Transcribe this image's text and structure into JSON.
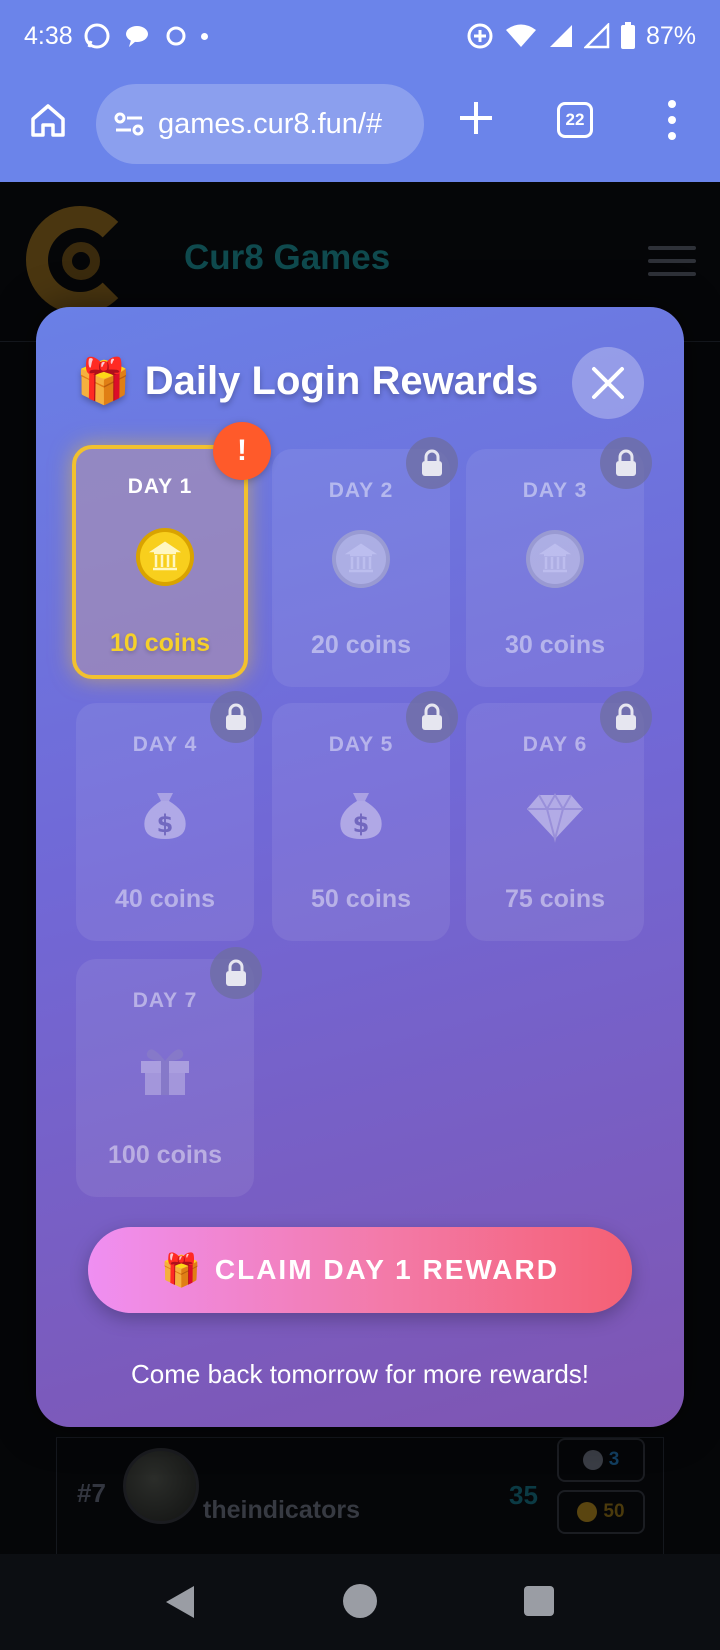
{
  "status_bar": {
    "time": "4:38",
    "battery": "87%"
  },
  "browser": {
    "url": "games.cur8.fun/#",
    "tab_count": "22"
  },
  "background_page": {
    "site_title": "Cur8 Games",
    "leaderboard_row": {
      "rank": "#7",
      "username": "theindicators",
      "score": "35",
      "steem_count": "3",
      "coins_count": "50"
    }
  },
  "modal": {
    "title_icon": "🎁",
    "title": "Daily Login Rewards",
    "days": [
      {
        "label": "DAY 1",
        "coins": "10 coins",
        "icon": "gold-coin-icon",
        "state": "active",
        "badge": "!"
      },
      {
        "label": "DAY 2",
        "coins": "20 coins",
        "icon": "silver-coin-icon",
        "state": "locked"
      },
      {
        "label": "DAY 3",
        "coins": "30 coins",
        "icon": "silver-coin-icon",
        "state": "locked"
      },
      {
        "label": "DAY 4",
        "coins": "40 coins",
        "icon": "money-bag-icon",
        "state": "locked"
      },
      {
        "label": "DAY 5",
        "coins": "50 coins",
        "icon": "money-bag-icon",
        "state": "locked"
      },
      {
        "label": "DAY 6",
        "coins": "75 coins",
        "icon": "gem-icon",
        "state": "locked"
      },
      {
        "label": "DAY 7",
        "coins": "100 coins",
        "icon": "gift-icon",
        "state": "locked"
      }
    ],
    "claim_icon": "🎁",
    "claim_label": "CLAIM DAY 1 REWARD",
    "footer": "Come back tomorrow for more rewards!"
  },
  "colors": {
    "accent_gold": "#f2c12e",
    "alert": "#ff5a2a",
    "browser_bar": "#6b84ea"
  }
}
